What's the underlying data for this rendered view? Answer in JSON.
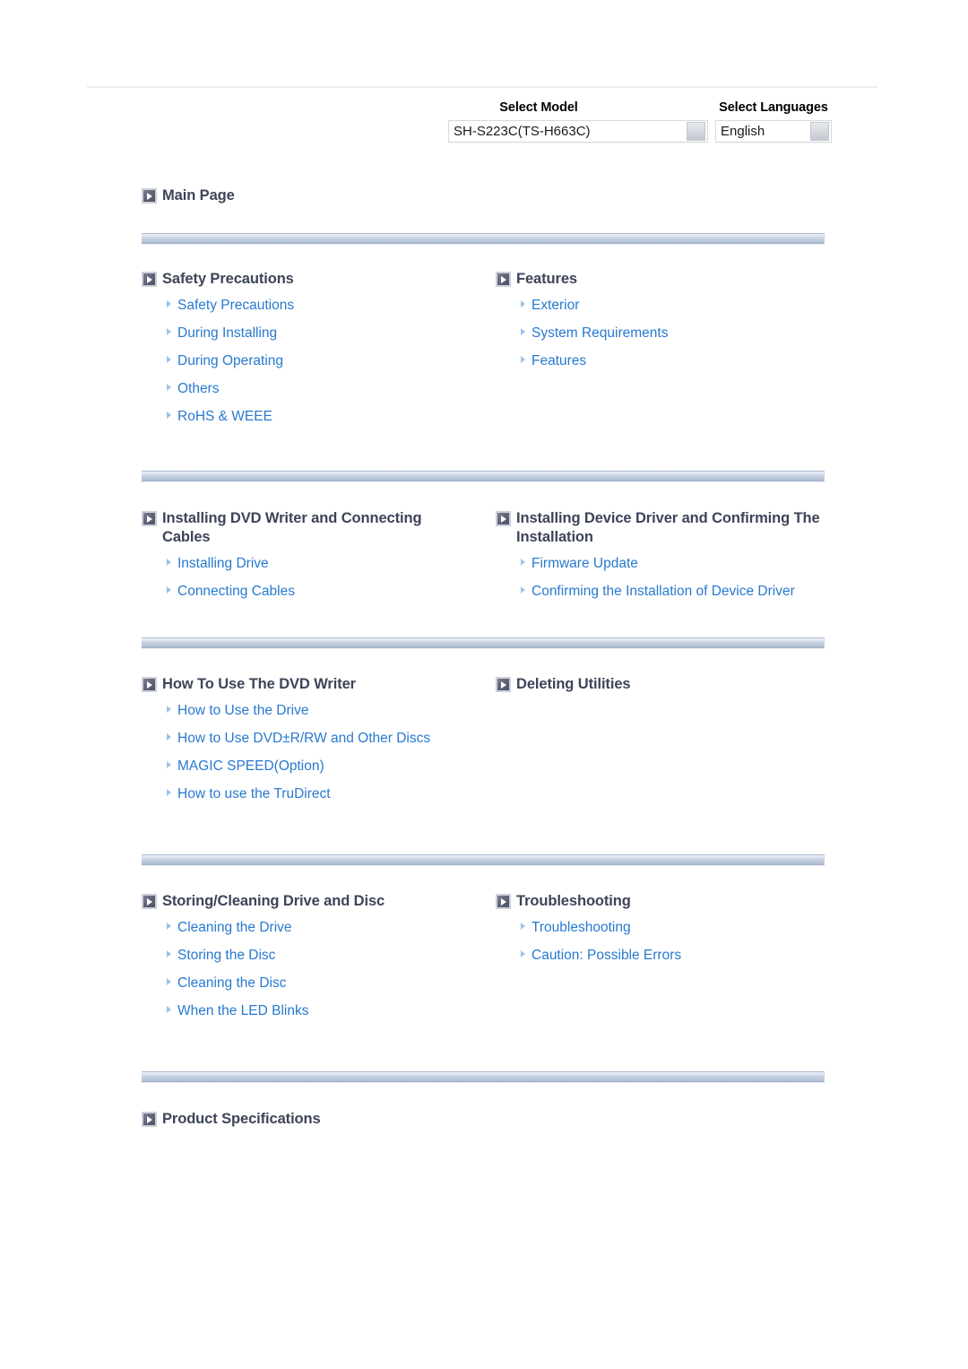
{
  "selectors": {
    "model": {
      "label": "Select Model",
      "value": "SH-S223C(TS-H663C)",
      "arrow_icon": "dropdown-arrow-icon"
    },
    "language": {
      "label": "Select Languages",
      "value": "English",
      "arrow_icon": "dropdown-arrow-icon"
    }
  },
  "colors": {
    "link": "#2879d0",
    "heading": "#3d4458",
    "bullet": "#9cc3ea",
    "divider": "#c7d2e2"
  },
  "main_page": {
    "title": "Main Page",
    "icon": "play-square-icon"
  },
  "sections": [
    {
      "left": {
        "title": "Safety Precautions",
        "icon": "play-square-icon",
        "items": [
          "Safety Precautions",
          "During Installing",
          "During Operating",
          "Others",
          "RoHS & WEEE"
        ]
      },
      "right": {
        "title": "Features",
        "icon": "play-square-icon",
        "items": [
          "Exterior",
          "System Requirements",
          "Features"
        ]
      }
    },
    {
      "left": {
        "title": "Installing DVD Writer and Connecting Cables",
        "icon": "play-square-icon",
        "items": [
          "Installing Drive",
          "Connecting Cables"
        ]
      },
      "right": {
        "title": "Installing Device Driver and Confirming The Installation",
        "icon": "play-square-icon",
        "items": [
          "Firmware Update",
          "Confirming the Installation of Device Driver"
        ]
      }
    },
    {
      "left": {
        "title": "How To Use The DVD Writer",
        "icon": "play-square-icon",
        "items": [
          "How to Use the Drive",
          "How to Use DVD±R/RW and Other Discs",
          "MAGIC SPEED(Option)",
          "How to use the TruDirect"
        ]
      },
      "right": {
        "title": "Deleting Utilities",
        "icon": "play-square-icon",
        "items": []
      }
    },
    {
      "left": {
        "title": "Storing/Cleaning Drive and Disc",
        "icon": "play-square-icon",
        "items": [
          "Cleaning the Drive",
          "Storing the Disc",
          "Cleaning the Disc",
          "When the LED Blinks"
        ]
      },
      "right": {
        "title": "Troubleshooting",
        "icon": "play-square-icon",
        "items": [
          "Troubleshooting",
          "Caution: Possible Errors"
        ]
      }
    }
  ],
  "footer_section": {
    "title": "Product Specifications",
    "icon": "play-square-icon"
  }
}
